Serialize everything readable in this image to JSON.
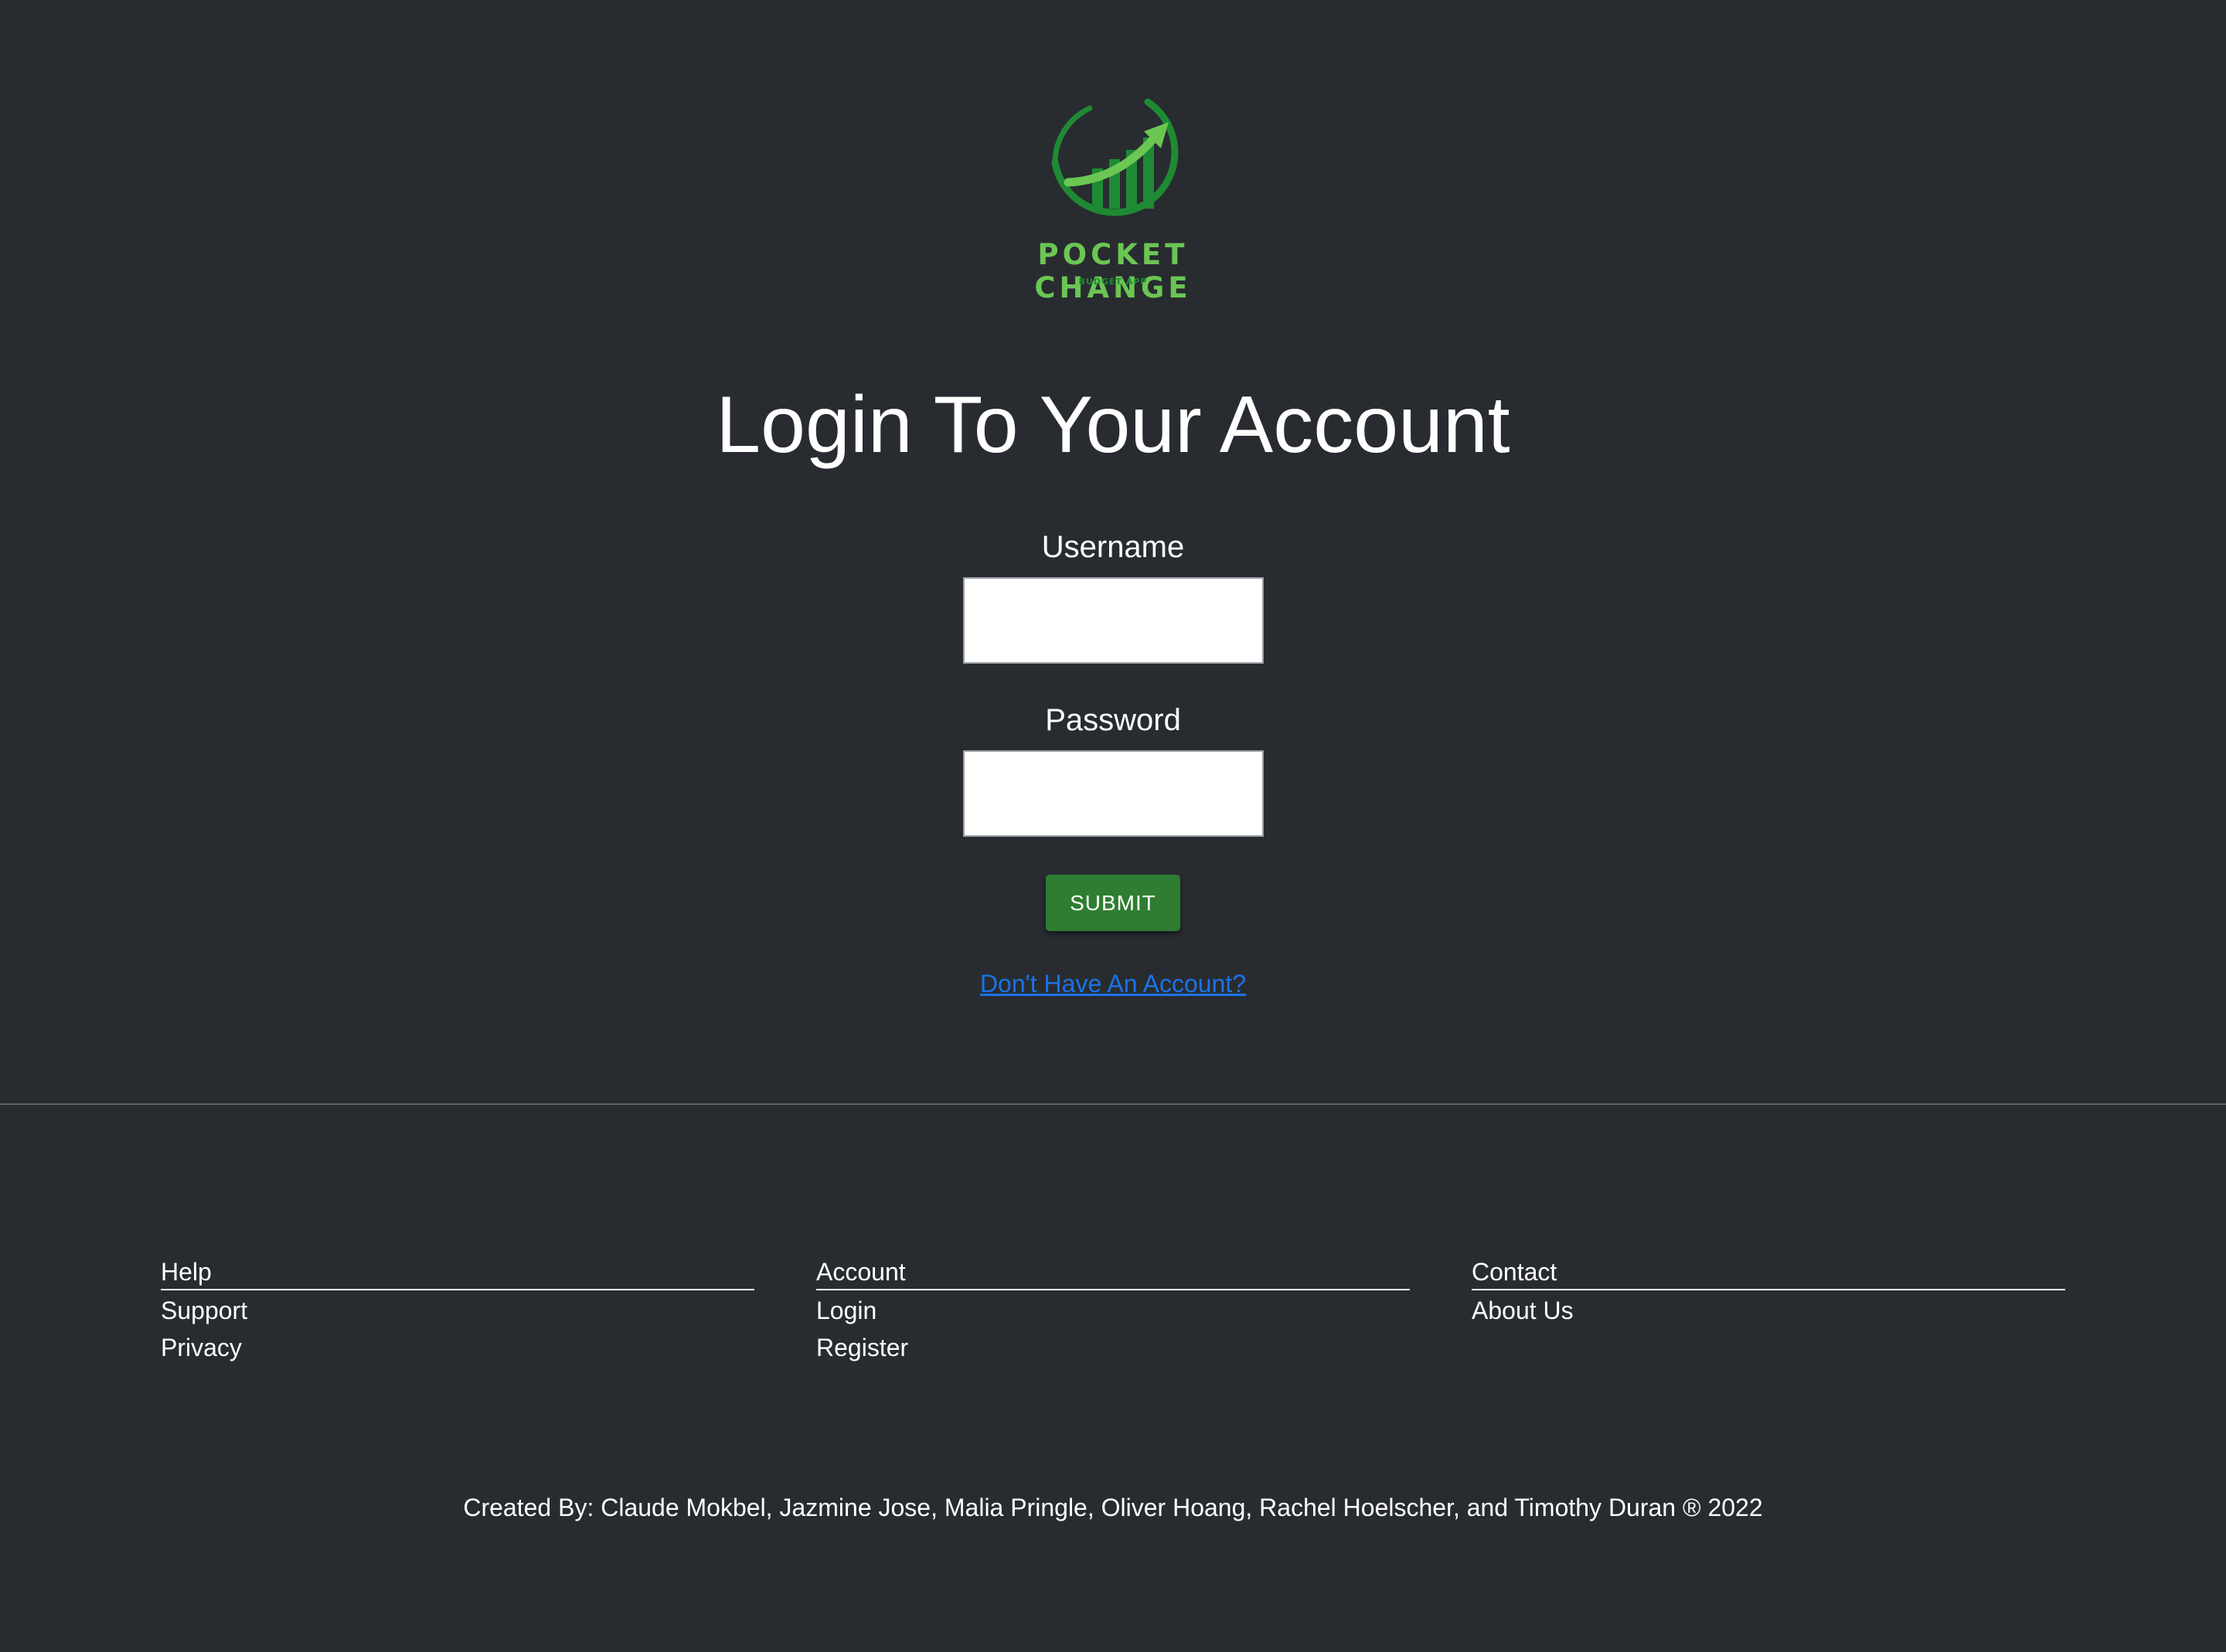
{
  "brand": {
    "name": "POCKET CHANGE",
    "tagline": "BUDGET APP",
    "colors": {
      "primary": "#6bc653",
      "dark": "#1f8a34"
    }
  },
  "page": {
    "heading": "Login To Your Account",
    "background": "#282c30"
  },
  "form": {
    "username_label": "Username",
    "username_value": "",
    "password_label": "Password",
    "password_value": "",
    "submit_label": "SUBMIT",
    "submit_color": "#2e7d32",
    "register_link": "Don't Have An Account?",
    "link_color": "#1a73e8"
  },
  "footer": {
    "columns": [
      {
        "title": "Help",
        "links": [
          "Support",
          "Privacy"
        ]
      },
      {
        "title": "Account",
        "links": [
          "Login",
          "Register"
        ]
      },
      {
        "title": "Contact",
        "links": [
          "About Us"
        ]
      }
    ],
    "credits": "Created By: Claude Mokbel, Jazmine Jose, Malia Pringle, Oliver Hoang, Rachel Hoelscher, and Timothy Duran ® 2022"
  }
}
